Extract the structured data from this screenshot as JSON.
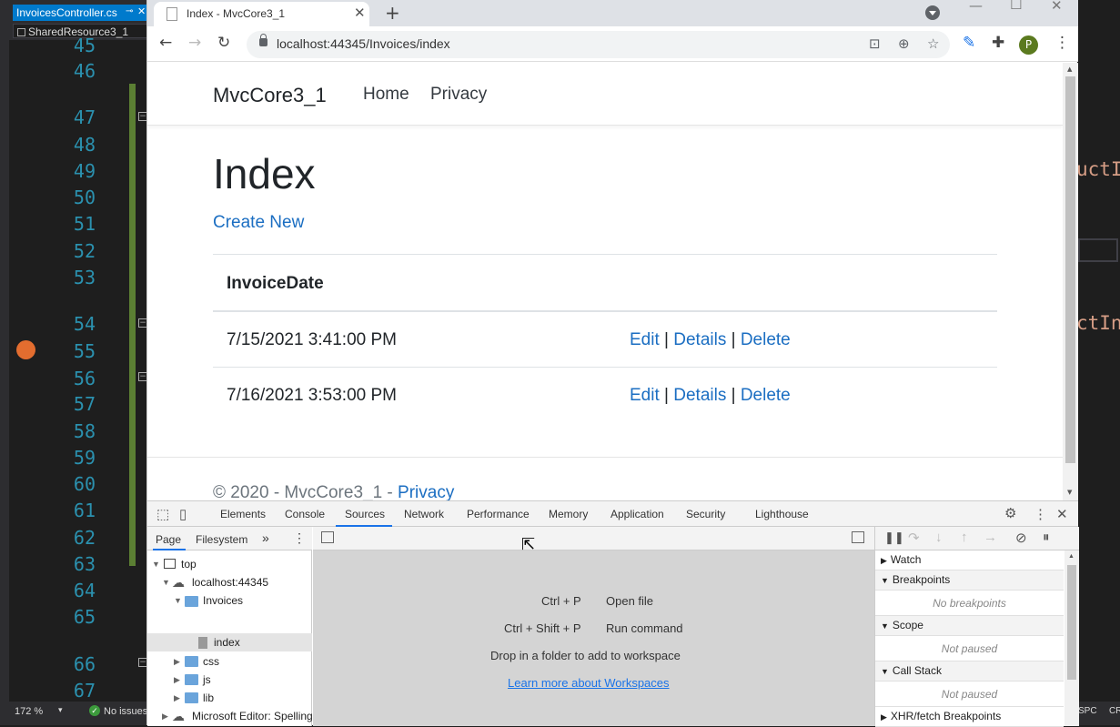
{
  "vs": {
    "tabs": [
      "InvoicesController.cs",
      "SharedResource3_1"
    ],
    "line_numbers": [
      "45",
      "46",
      "47",
      "48",
      "49",
      "50",
      "51",
      "52",
      "53",
      "54",
      "55",
      "56",
      "57",
      "58",
      "59",
      "60",
      "61",
      "62",
      "63",
      "64",
      "65",
      "66",
      "67"
    ],
    "status": {
      "zoom": "172 %",
      "issues": "No issues",
      "right_labels": [
        "SPC",
        "CR"
      ]
    },
    "right_code": [
      "uctI",
      "ctIn"
    ]
  },
  "browser": {
    "tab_title": "Index - MvcCore3_1",
    "url": "localhost:44345/Invoices/index",
    "profile_initial": "P"
  },
  "page": {
    "brand": "MvcCore3_1",
    "nav": [
      "Home",
      "Privacy"
    ],
    "heading": "Index",
    "create_link": "Create New",
    "column_header": "InvoiceDate",
    "rows": [
      {
        "date": "7/15/2021 3:41:00 PM",
        "edit": "Edit",
        "details": "Details",
        "delete": "Delete"
      },
      {
        "date": "7/16/2021 3:53:00 PM",
        "edit": "Edit",
        "details": "Details",
        "delete": "Delete"
      }
    ],
    "separator": "|",
    "footer_text": "© 2020 - MvcCore3_1 - ",
    "footer_link": "Privacy"
  },
  "devtools": {
    "tabs": [
      "Elements",
      "Console",
      "Sources",
      "Network",
      "Performance",
      "Memory",
      "Application",
      "Security",
      "Lighthouse"
    ],
    "active_tab": "Sources",
    "navigator_tabs": [
      "Page",
      "Filesystem"
    ],
    "tree": {
      "top": "top",
      "origin": "localhost:44345",
      "folder": "Invoices",
      "file": "index",
      "others": [
        "css",
        "js",
        "lib"
      ],
      "extension": "Microsoft Editor: Spelling"
    },
    "shortcuts": [
      {
        "keys": "Ctrl + P",
        "action": "Open file"
      },
      {
        "keys": "Ctrl + Shift + P",
        "action": "Run command"
      }
    ],
    "drop_text": "Drop in a folder to add to workspace",
    "learn_link": "Learn more about Workspaces",
    "sections": {
      "watch": "Watch",
      "breakpoints": "Breakpoints",
      "no_breakpoints": "No breakpoints",
      "scope": "Scope",
      "not_paused": "Not paused",
      "call_stack": "Call Stack",
      "not_paused_2": "Not paused",
      "xhr": "XHR/fetch Breakpoints"
    }
  }
}
